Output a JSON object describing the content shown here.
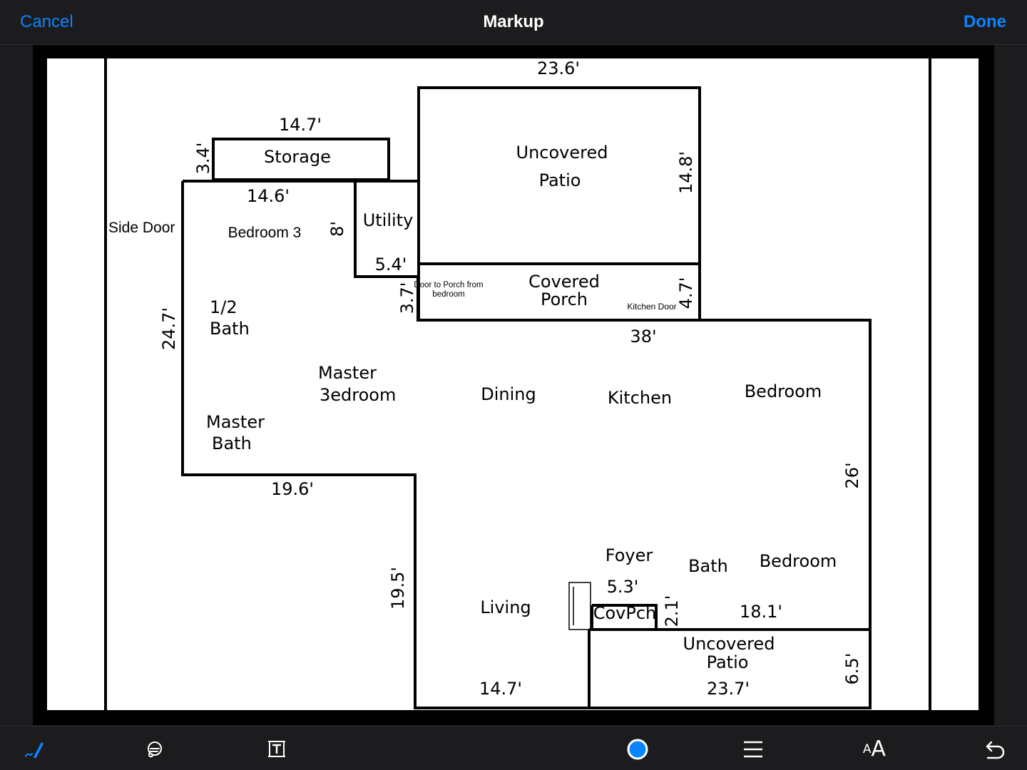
{
  "nav": {
    "cancel": "Cancel",
    "title": "Markup",
    "done": "Done"
  },
  "colors": {
    "accent": "#0a84ff",
    "bar": "#1c1c1e",
    "page": "#ffffff",
    "ink": "#000000"
  },
  "floorplan": {
    "rooms": {
      "storage": "Storage",
      "bedroom3": "Bedroom 3",
      "utility": "Utility",
      "uncovered_patio_top_1": "Uncovered",
      "uncovered_patio_top_2": "Patio",
      "covered_porch_1": "Covered",
      "covered_porch_2": "Porch",
      "half_bath_1": "1/2",
      "half_bath_2": "Bath",
      "master_bedroom_1": "Master",
      "master_bedroom_2": "3edroom",
      "master_bath_1": "Master",
      "master_bath_2": "Bath",
      "dining": "Dining",
      "kitchen": "Kitchen",
      "bedroom_right": "Bedroom",
      "foyer": "Foyer",
      "bath": "Bath",
      "bedroom_lower": "Bedroom",
      "living": "Living",
      "covpch": "CovPch",
      "uncovered_patio_bottom_1": "Uncovered",
      "uncovered_patio_bottom_2": "Patio"
    },
    "notes": {
      "side_door": "Side Door",
      "door_to_porch_1": "Door to Porch from",
      "door_to_porch_2": "bedroom",
      "kitchen_door": "Kitchen Door"
    },
    "dimensions": {
      "top_width": "23.6'",
      "storage_width": "14.7'",
      "storage_height": "3.4'",
      "bedroom3_width": "14.6'",
      "bedroom3_depth": "8'",
      "utility_width": "5.4'",
      "porch_height": "3.7'",
      "patio_height": "14.8'",
      "covered_porch_height": "4.7'",
      "main_width": "38'",
      "left_height": "24.7'",
      "master_wing_width": "19.6'",
      "right_height": "26'",
      "living_height": "19.5'",
      "foyer_width": "5.3'",
      "covpch_height": "2.1'",
      "bedroom_width": "18.1'",
      "living_width": "14.7'",
      "bottom_patio_width": "23.7'",
      "bottom_patio_height": "6.5'"
    }
  },
  "toolbar": {
    "tools": [
      "pen-icon",
      "lasso-icon",
      "text-box-icon",
      "color-icon",
      "line-weight-icon",
      "font-size-icon",
      "undo-icon"
    ],
    "font_small": "A",
    "font_large": "A"
  }
}
